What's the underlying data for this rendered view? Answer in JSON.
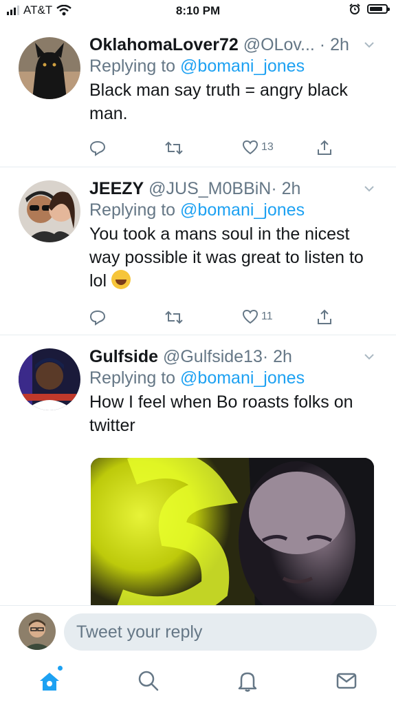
{
  "status_bar": {
    "carrier": "AT&T",
    "time": "8:10 PM"
  },
  "tweets": [
    {
      "name": "OklahomaLover72",
      "handle": "@OLov...",
      "time": "· 2h",
      "replying_prefix": "Replying to",
      "replying_to": "@bomani_jones",
      "text": "Black man say truth = angry black man.",
      "likes": "13"
    },
    {
      "name": "JEEZY",
      "handle": "@JUS_M0BBiN",
      "time": "· 2h",
      "replying_prefix": "Replying to",
      "replying_to": "@bomani_jones",
      "text": "You took a mans soul in the nicest way possible it was great to listen to lol",
      "likes": "11"
    },
    {
      "name": "Gulfside",
      "handle": "@Gulfside13",
      "time": "· 2h",
      "replying_prefix": "Replying to",
      "replying_to": "@bomani_jones",
      "text": "How I feel when Bo roasts folks on twitter"
    }
  ],
  "compose": {
    "placeholder": "Tweet your reply"
  },
  "icons": {
    "reply": "reply-icon",
    "retweet": "retweet-icon",
    "like": "heart-icon",
    "share": "share-icon",
    "home": "home-icon",
    "search": "search-icon",
    "notifications": "bell-icon",
    "messages": "mail-icon"
  },
  "colors": {
    "accent": "#1da1f2",
    "secondary_text": "#657786",
    "divider": "#e6ecf0"
  }
}
